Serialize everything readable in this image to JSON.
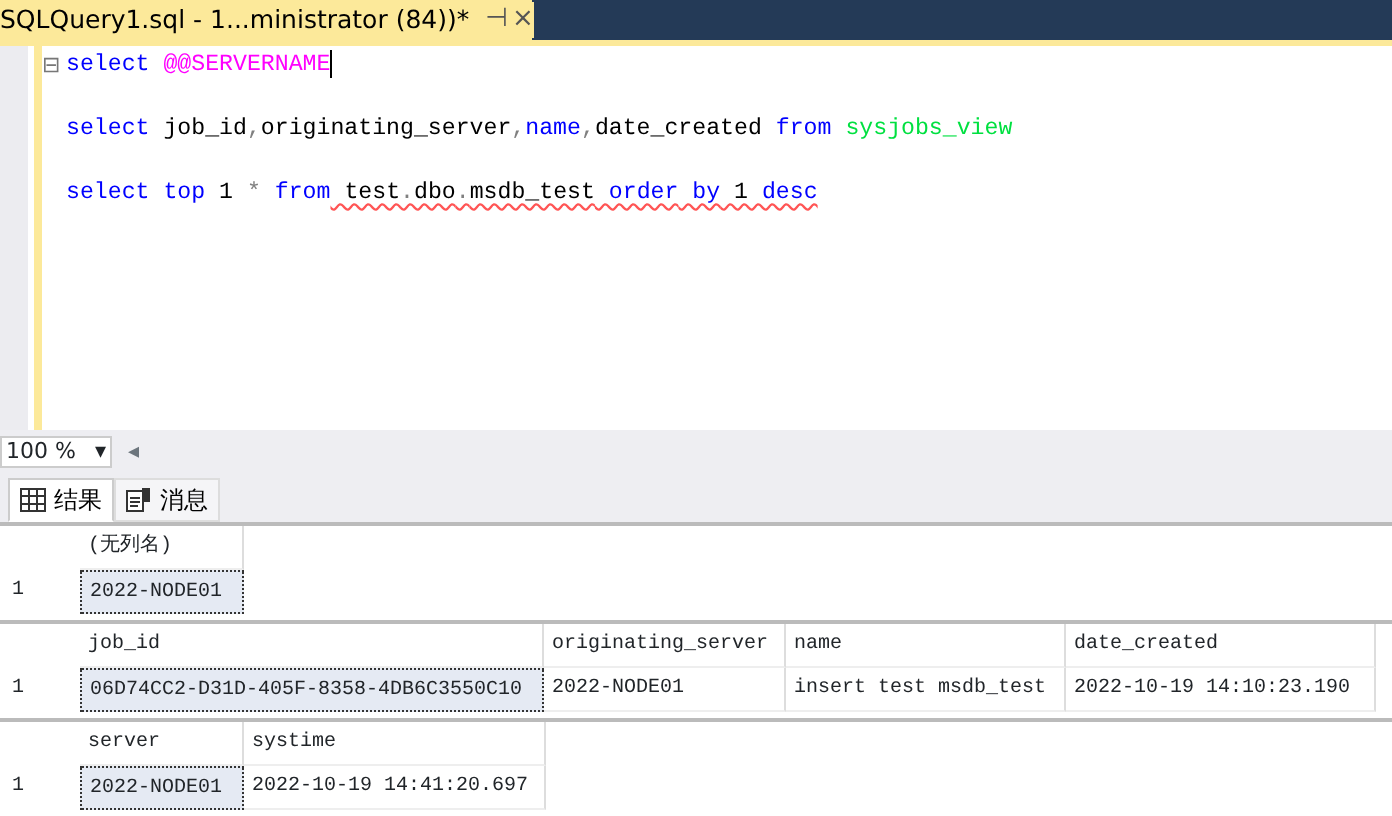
{
  "document_tab": {
    "title": "SQLQuery1.sql - 1...ministrator (84))*",
    "pin": "⊣",
    "close": "×"
  },
  "editor": {
    "lines": [
      {
        "tokens": [
          {
            "text": "select",
            "kind": "keyword",
            "squiggle": false
          },
          {
            "text": " @@SERVERNAME",
            "kind": "function",
            "squiggle": false
          }
        ],
        "fold": "⊟",
        "caret": true
      },
      {
        "caret": false
      },
      {
        "tokens": [
          {
            "text": "select",
            "kind": "keyword",
            "squiggle": false
          },
          {
            "text": " job_id",
            "kind": "plain",
            "squiggle": false
          },
          {
            "text": ",",
            "kind": "operator",
            "squiggle": false
          },
          {
            "text": "originating_server",
            "kind": "plain",
            "squiggle": false
          },
          {
            "text": ",",
            "kind": "operator",
            "squiggle": false
          },
          {
            "text": "name",
            "kind": "keyword",
            "squiggle": false
          },
          {
            "text": ",",
            "kind": "operator",
            "squiggle": false
          },
          {
            "text": "date_created",
            "kind": "plain",
            "squiggle": false
          },
          {
            "text": " from",
            "kind": "keyword",
            "squiggle": false
          },
          {
            "text": " sysjobs_view",
            "kind": "system",
            "squiggle": false
          }
        ],
        "caret": false
      },
      {
        "caret": false
      },
      {
        "tokens": [
          {
            "text": "select",
            "kind": "keyword",
            "squiggle": false
          },
          {
            "text": " top",
            "kind": "keyword",
            "squiggle": false
          },
          {
            "text": " 1",
            "kind": "plain",
            "squiggle": false
          },
          {
            "text": " *",
            "kind": "operator",
            "squiggle": false
          },
          {
            "text": " from",
            "kind": "keyword",
            "squiggle": false
          },
          {
            "text": " test",
            "kind": "plain",
            "squiggle": true
          },
          {
            "text": ".",
            "kind": "operator",
            "squiggle": true
          },
          {
            "text": "dbo",
            "kind": "plain",
            "squiggle": true
          },
          {
            "text": ".",
            "kind": "operator",
            "squiggle": true
          },
          {
            "text": "msdb_test",
            "kind": "plain",
            "squiggle": true
          },
          {
            "text": " order",
            "kind": "keyword",
            "squiggle": true
          },
          {
            "text": " by",
            "kind": "keyword",
            "squiggle": true
          },
          {
            "text": " 1",
            "kind": "plain",
            "squiggle": true
          },
          {
            "text": " desc",
            "kind": "keyword",
            "squiggle": true
          }
        ],
        "caret": false
      }
    ]
  },
  "zoom": {
    "value": "100 %",
    "caret": "▾",
    "scroll_left": "◂"
  },
  "result_tabs": [
    {
      "label": "结果",
      "kind": "grid",
      "selected": true
    },
    {
      "label": "消息",
      "kind": "messages",
      "selected": false
    }
  ],
  "grids": [
    {
      "columns": [
        "(无列名)"
      ],
      "rows": [
        {
          "number": "1",
          "cells": [
            "2022-NODE01"
          ]
        }
      ]
    },
    {
      "columns": [
        "job_id",
        "originating_server",
        "name",
        "date_created"
      ],
      "rows": [
        {
          "number": "1",
          "cells": [
            "06D74CC2-D31D-405F-8358-4DB6C3550C10",
            "2022-NODE01",
            "insert test msdb_test",
            "2022-10-19 14:10:23.190"
          ]
        }
      ]
    },
    {
      "columns": [
        "server",
        "systime"
      ],
      "rows": [
        {
          "number": "1",
          "cells": [
            "2022-NODE01",
            "2022-10-19 14:41:20.697"
          ]
        }
      ]
    }
  ]
}
